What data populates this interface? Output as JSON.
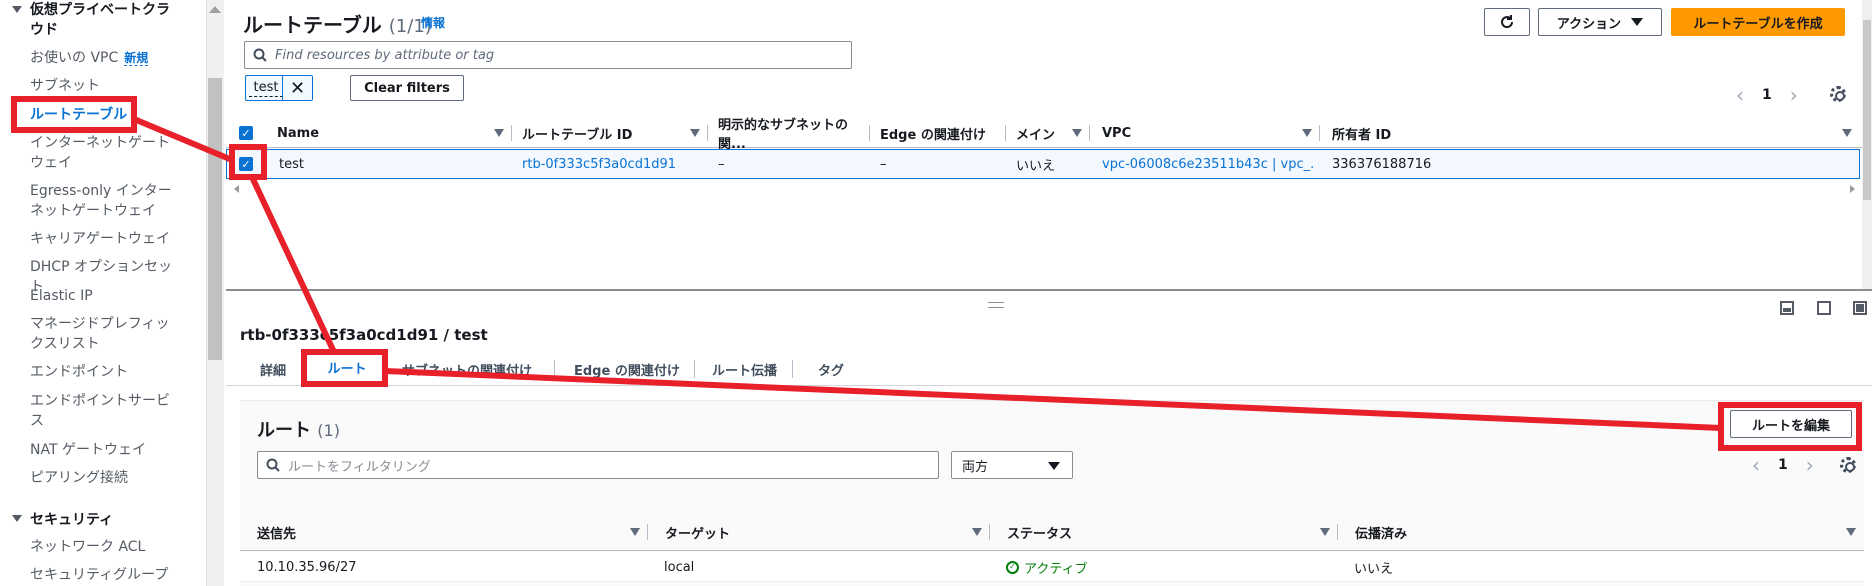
{
  "sidebar": {
    "section_vpc": "仮想プライベートクラウド",
    "items": [
      {
        "label": "お使いの VPC",
        "badge": "新規"
      },
      {
        "label": "サブネット"
      },
      {
        "label": "ルートテーブル"
      },
      {
        "label": "インターネットゲートウェイ"
      },
      {
        "label": "Egress-only インターネットゲートウェイ"
      },
      {
        "label": "キャリアゲートウェイ"
      },
      {
        "label": "DHCP オプションセット"
      },
      {
        "label": "Elastic IP"
      },
      {
        "label": "マネージドプレフィックスリスト"
      },
      {
        "label": "エンドポイント"
      },
      {
        "label": "エンドポイントサービス"
      },
      {
        "label": "NAT ゲートウェイ"
      },
      {
        "label": "ピアリング接続"
      }
    ],
    "section_security": "セキュリティ",
    "security_items": [
      {
        "label": "ネットワーク ACL"
      },
      {
        "label": "セキュリティグループ"
      }
    ]
  },
  "header": {
    "title": "ルートテーブル",
    "count": "(1/1)",
    "info": "情報",
    "actions_label": "アクション",
    "create_label": "ルートテーブルを作成"
  },
  "filter": {
    "placeholder": "Find resources by attribute or tag",
    "token": "test",
    "clear_label": "Clear filters"
  },
  "pager": {
    "page": "1"
  },
  "table": {
    "columns": [
      "Name",
      "ルートテーブル ID",
      "明示的なサブネットの関...",
      "Edge の関連付け",
      "メイン",
      "VPC",
      "所有者 ID"
    ],
    "rows": [
      {
        "name": "test",
        "rtb_id": "rtb-0f333c5f3a0cd1d91",
        "subnet": "–",
        "edge": "–",
        "main": "いいえ",
        "vpc": "vpc-06008c6e23511b43c | vpc_...",
        "owner": "336376188716"
      }
    ]
  },
  "detail": {
    "title": "rtb-0f333c5f3a0cd1d91 / test",
    "tabs": [
      "詳細",
      "ルート",
      "サブネットの関連付け",
      "Edge の関連付け",
      "ルート伝播",
      "タグ"
    ],
    "active_tab": "ルート"
  },
  "routes": {
    "title": "ルート",
    "count": "(1)",
    "edit_label": "ルートを編集",
    "filter_placeholder": "ルートをフィルタリング",
    "select_value": "両方",
    "page": "1",
    "columns": [
      "送信先",
      "ターゲット",
      "ステータス",
      "伝播済み"
    ],
    "rows": [
      {
        "dest": "10.10.35.96/27",
        "target": "local",
        "status": "アクティブ",
        "propagated": "いいえ"
      }
    ]
  },
  "colors": {
    "accent": "#0972d3",
    "primary_button": "#ff9900",
    "annotation": "#e8202a",
    "status_ok": "#037f0c"
  }
}
